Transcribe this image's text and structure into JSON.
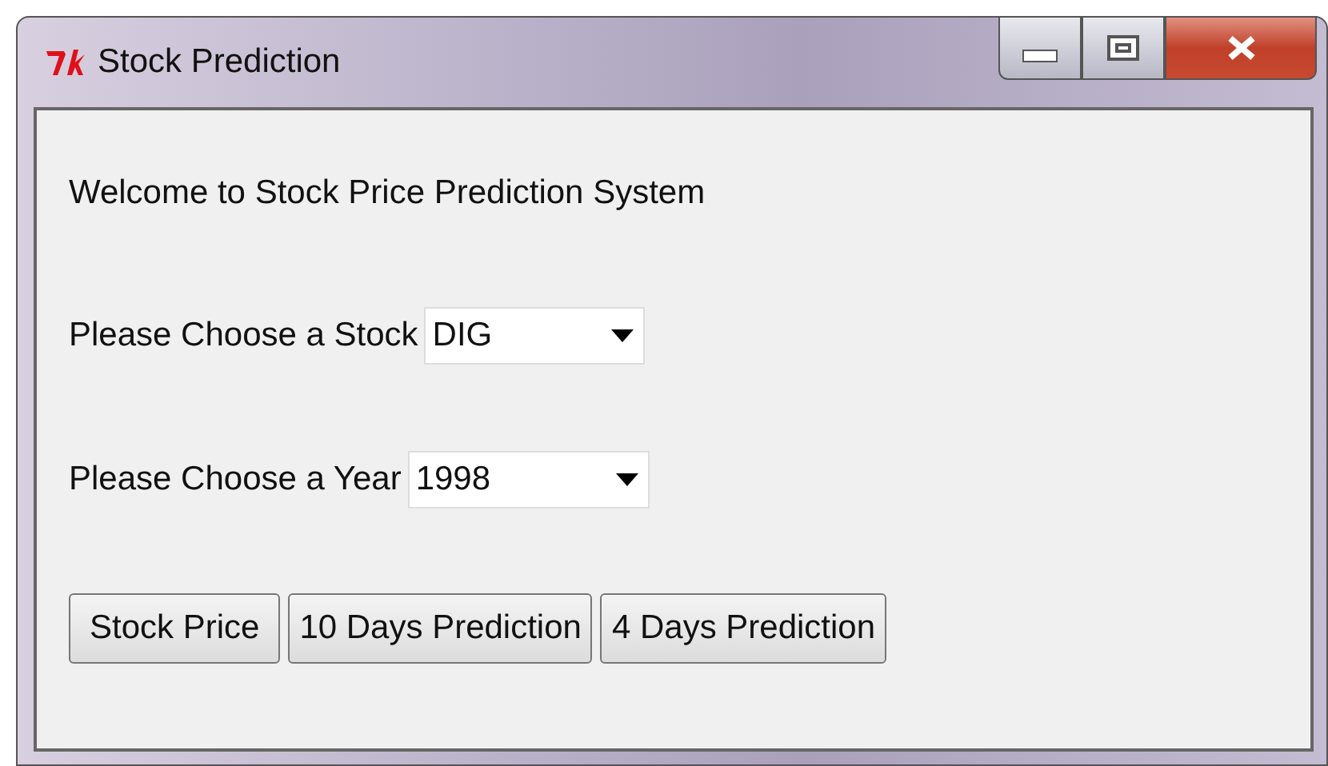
{
  "window": {
    "title": "Stock Prediction"
  },
  "welcome": "Welcome to Stock Price Prediction System",
  "fields": [
    {
      "label": "Please Choose a Stock",
      "value": "DIG"
    },
    {
      "label": "Please Choose a Year",
      "value": "1998"
    }
  ],
  "buttons": [
    "Stock Price",
    "10 Days Prediction",
    "4 Days Prediction"
  ]
}
